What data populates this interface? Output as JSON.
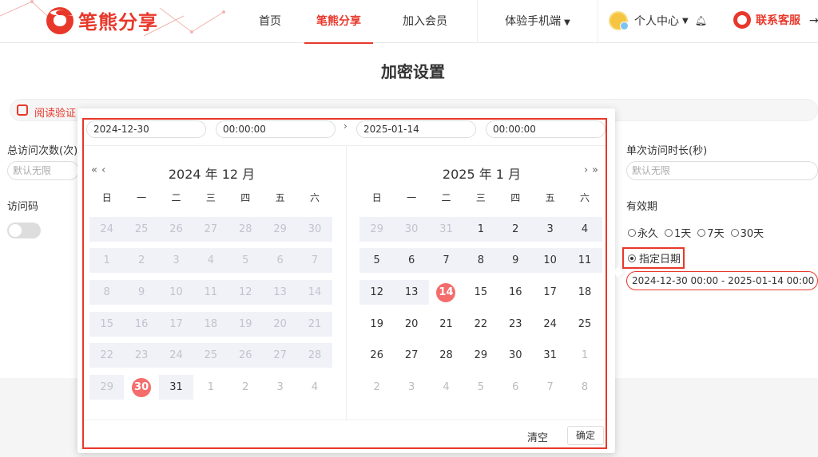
{
  "header": {
    "logo_text": "笔熊分享",
    "nav": [
      "首页",
      "笔熊分享",
      "加入会员",
      "体验手机端"
    ],
    "user_label": "个人中心",
    "service_label": "联系客服"
  },
  "page": {
    "title": "加密设置",
    "toolbar_label": "阅读验证：",
    "total_visits_label": "总访问次数(次)",
    "total_visits_placeholder": "默认无限",
    "access_code_label": "访问码",
    "single_visit_label": "单次访问时长(秒)",
    "single_visit_placeholder": "默认无限",
    "validity_label": "有效期",
    "validity_options": [
      "永久",
      "1天",
      "7天",
      "30天"
    ],
    "specified_date_label": "指定日期",
    "date_range_value": "2024-12-30 00:00  -  2025-01-14 00:00"
  },
  "picker": {
    "start_date": "2024-12-30",
    "start_time": "00:00:00",
    "end_date": "2025-01-14",
    "end_time": "00:00:00",
    "left_month": "2024 年 12 月",
    "right_month": "2025 年 1 月",
    "weekdays": [
      "日",
      "一",
      "二",
      "三",
      "四",
      "五",
      "六"
    ],
    "left_weeks": [
      [
        "24",
        "25",
        "26",
        "27",
        "28",
        "29",
        "30"
      ],
      [
        "1",
        "2",
        "3",
        "4",
        "5",
        "6",
        "7"
      ],
      [
        "8",
        "9",
        "10",
        "11",
        "12",
        "13",
        "14"
      ],
      [
        "15",
        "16",
        "17",
        "18",
        "19",
        "20",
        "21"
      ],
      [
        "22",
        "23",
        "24",
        "25",
        "26",
        "27",
        "28"
      ],
      [
        "29",
        "30",
        "31",
        "1",
        "2",
        "3",
        "4"
      ]
    ],
    "right_weeks": [
      [
        "29",
        "30",
        "31",
        "1",
        "2",
        "3",
        "4"
      ],
      [
        "5",
        "6",
        "7",
        "8",
        "9",
        "10",
        "11"
      ],
      [
        "12",
        "13",
        "14",
        "15",
        "16",
        "17",
        "18"
      ],
      [
        "19",
        "20",
        "21",
        "22",
        "23",
        "24",
        "25"
      ],
      [
        "26",
        "27",
        "28",
        "29",
        "30",
        "31",
        "1"
      ],
      [
        "2",
        "3",
        "4",
        "5",
        "6",
        "7",
        "8"
      ]
    ],
    "clear_label": "清空",
    "confirm_label": "确定"
  }
}
